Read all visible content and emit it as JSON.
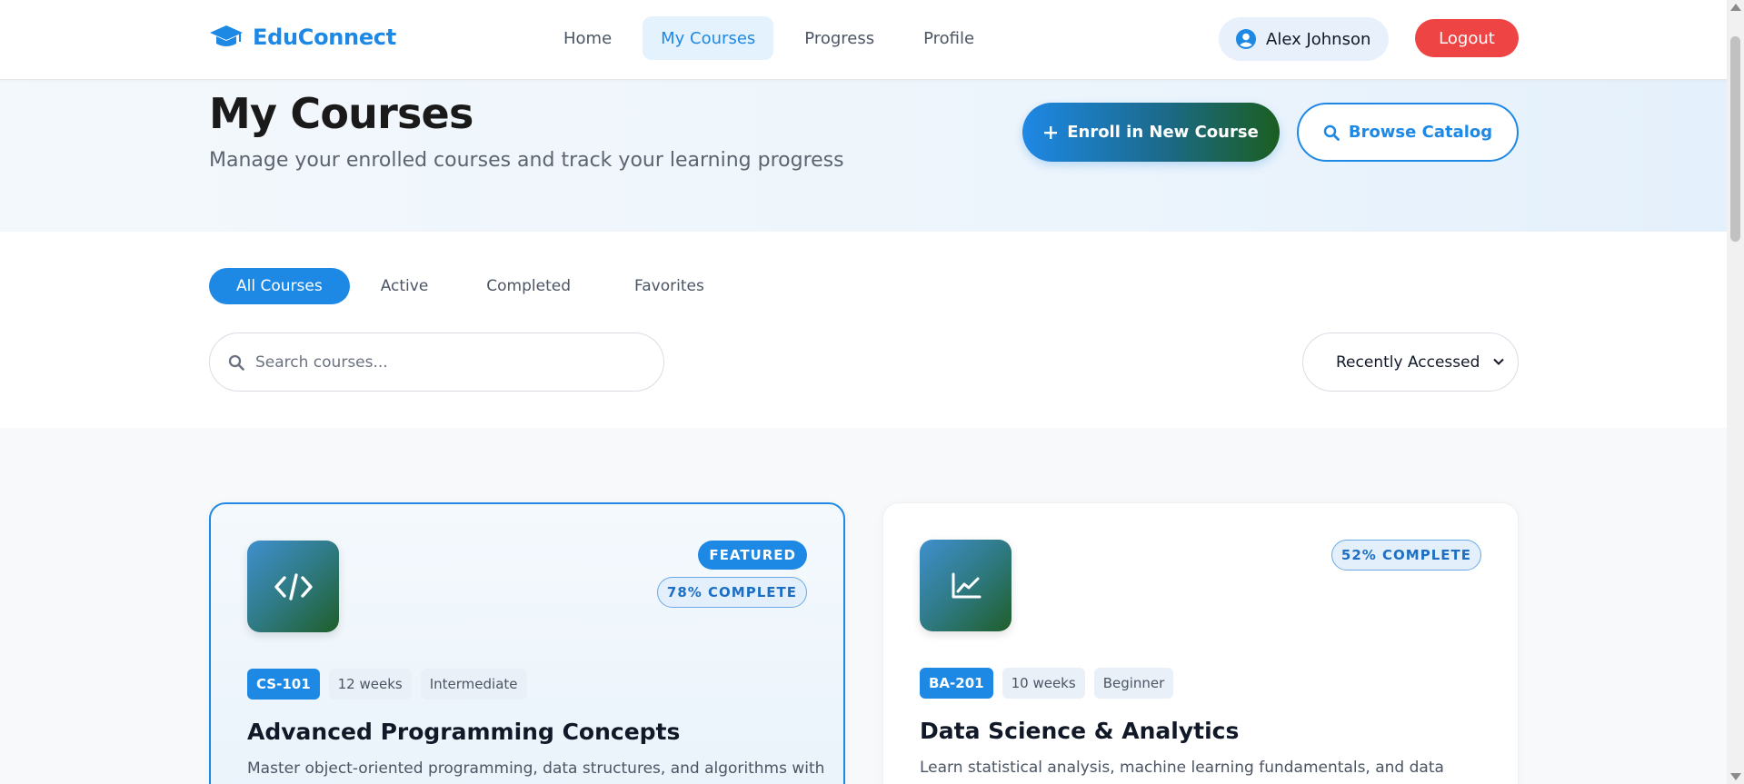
{
  "brand": {
    "name": "EduConnect",
    "icon": "graduation-cap-icon",
    "color": "#1e88e5"
  },
  "nav": {
    "items": [
      {
        "label": "Home",
        "active": false
      },
      {
        "label": "My Courses",
        "active": true
      },
      {
        "label": "Progress",
        "active": false
      },
      {
        "label": "Profile",
        "active": false
      }
    ]
  },
  "user": {
    "name": "Alex Johnson",
    "icon": "user-circle-icon"
  },
  "logout_label": "Logout",
  "hero": {
    "title": "My Courses",
    "subtitle": "Manage your enrolled courses and track your learning progress",
    "enroll_label": "Enroll in New Course",
    "browse_label": "Browse Catalog"
  },
  "filters": {
    "tabs": [
      {
        "label": "All Courses",
        "active": true
      },
      {
        "label": "Active",
        "active": false
      },
      {
        "label": "Completed",
        "active": false
      },
      {
        "label": "Favorites",
        "active": false
      }
    ],
    "search_placeholder": "Search courses...",
    "sort_selected": "Recently Accessed"
  },
  "courses": [
    {
      "icon": "code-icon",
      "featured": true,
      "featured_label": "FEATURED",
      "progress": 78,
      "progress_label": "78% COMPLETE",
      "code": "CS-101",
      "duration": "12 weeks",
      "level": "Intermediate",
      "title": "Advanced Programming Concepts",
      "description": "Master object-oriented programming, data structures, and algorithms with"
    },
    {
      "icon": "chart-line-icon",
      "featured": false,
      "progress": 52,
      "progress_label": "52% COMPLETE",
      "code": "BA-201",
      "duration": "10 weeks",
      "level": "Beginner",
      "title": "Data Science & Analytics",
      "description": "Learn statistical analysis, machine learning fundamentals, and data"
    }
  ],
  "colors": {
    "accent": "#1e88e5",
    "logout": "#ef4444",
    "success": "#1b5e20"
  }
}
